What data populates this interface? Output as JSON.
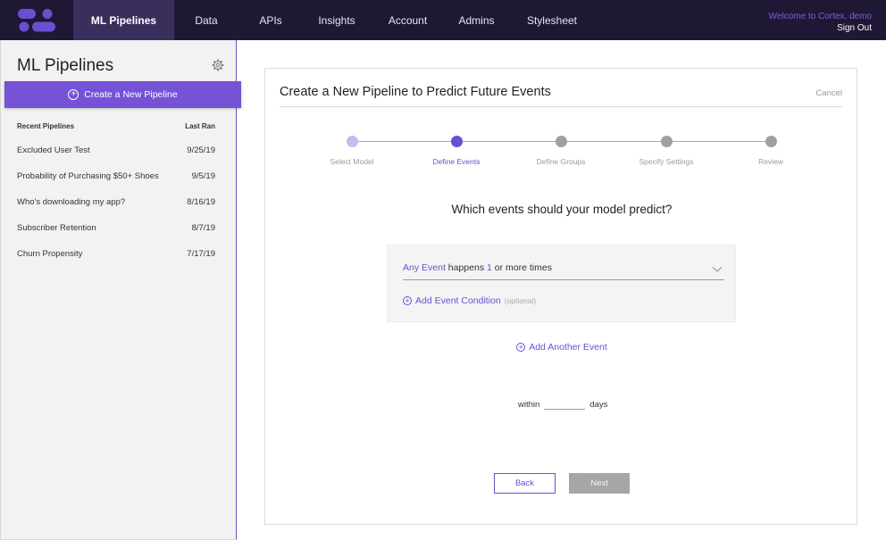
{
  "nav": {
    "items": [
      {
        "label": "ML Pipelines",
        "active": true
      },
      {
        "label": "Data",
        "active": false
      },
      {
        "label": "APIs",
        "active": false
      },
      {
        "label": "Insights",
        "active": false
      },
      {
        "label": "Account",
        "active": false
      },
      {
        "label": "Admins",
        "active": false
      },
      {
        "label": "Stylesheet",
        "active": false
      }
    ],
    "welcome": "Welcome to Cortex, demo",
    "sign_out": "Sign Out",
    "logo_icon": "cortex-logo-icon"
  },
  "sidebar": {
    "title": "ML Pipelines",
    "settings_icon": "gear-icon",
    "create_label": "Create a New Pipeline",
    "recent_header": "Recent Pipelines",
    "last_ran_header": "Last Ran",
    "recent": [
      {
        "name": "Excluded User Test",
        "date": "9/25/19"
      },
      {
        "name": "Probability of Purchasing $50+ Shoes",
        "date": "9/5/19"
      },
      {
        "name": "Who's downloading my app?",
        "date": "8/16/19"
      },
      {
        "name": "Subscriber Retention",
        "date": "8/7/19"
      },
      {
        "name": "Churn Propensity",
        "date": "7/17/19"
      }
    ]
  },
  "main": {
    "title": "Create a New Pipeline to Predict Future Events",
    "cancel": "Cancel",
    "steps": [
      {
        "label": "Select Model",
        "state": "done"
      },
      {
        "label": "Define Events",
        "state": "current"
      },
      {
        "label": "Define Groups",
        "state": "todo"
      },
      {
        "label": "Specify Settings",
        "state": "todo"
      },
      {
        "label": "Review",
        "state": "todo"
      }
    ],
    "question": "Which events should your model predict?",
    "event": {
      "event_link": "Any Event",
      "happens": " happens ",
      "count": "1",
      "suffix": " or more times"
    },
    "add_condition": "Add Event Condition",
    "optional": "(optional)",
    "add_another": "Add Another Event",
    "within": "within",
    "days": "days",
    "days_value": "",
    "back": "Back",
    "next": "Next"
  },
  "colors": {
    "nav_bg": "#1f1835",
    "nav_active": "#3a2f5c",
    "accent": "#7652d6",
    "step_done": "#c9b9ec",
    "step_current": "#6b4fd0",
    "step_todo": "#a0a0a0"
  }
}
